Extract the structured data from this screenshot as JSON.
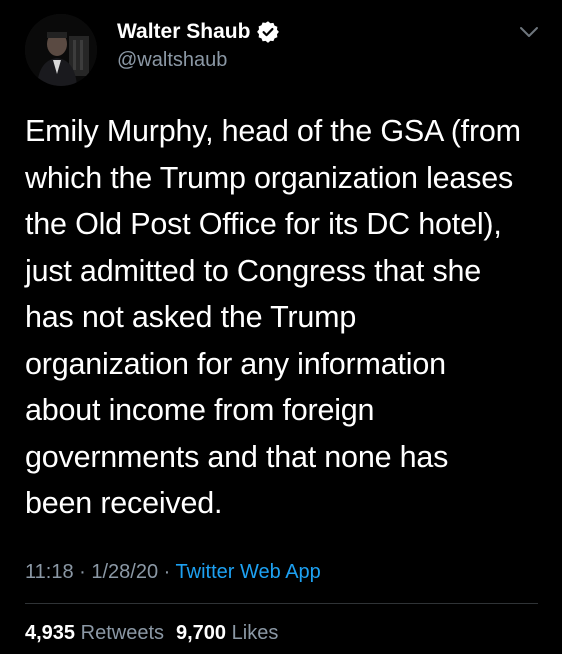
{
  "author": {
    "name": "Walter Shaub",
    "handle": "@waltshaub",
    "verified": true
  },
  "tweet": {
    "lines": [
      "Emily Murphy, head of the GSA (from",
      "which the Trump organization leases",
      "the Old Post Office for its DC hotel),",
      "just admitted to Congress that she",
      "has not asked the Trump",
      "organization for any information",
      "about income from foreign",
      "governments and that none has",
      "been received."
    ]
  },
  "meta": {
    "time": "11:18",
    "separator": "·",
    "date": "1/28/20",
    "source": "Twitter Web App"
  },
  "stats": {
    "retweets_count": "4,935",
    "retweets_label": "Retweets",
    "likes_count": "9,700",
    "likes_label": "Likes"
  },
  "icons": {
    "verified": "verified-badge-icon",
    "menu": "chevron-down-icon"
  },
  "colors": {
    "background": "#000000",
    "text": "#ffffff",
    "secondary": "#8b98a5",
    "link": "#1da1f2",
    "divider": "#2f3336"
  }
}
